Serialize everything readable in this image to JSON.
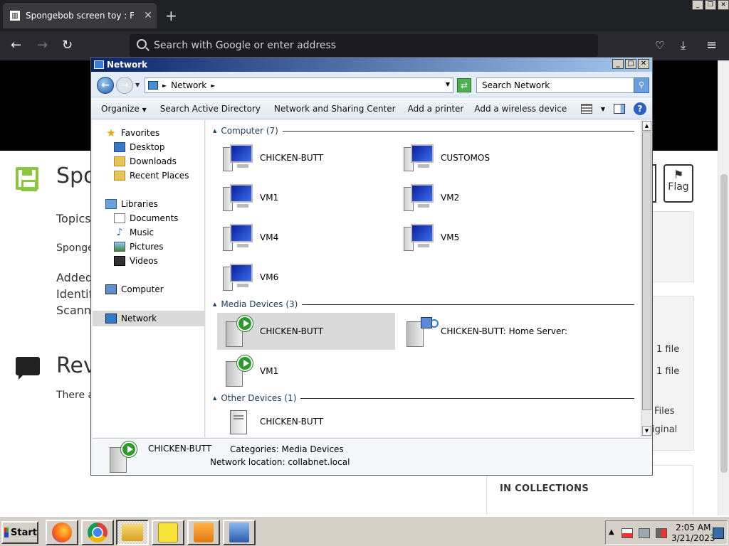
{
  "browser": {
    "tab_title": "Spongebob screen toy : Free Dow",
    "tab_close": "✕",
    "new_tab": "+",
    "address_placeholder": "Search with Google or enter address",
    "nav_icons": [
      "back-arrow-icon",
      "forward-arrow-icon",
      "reload-icon"
    ],
    "right_icons": [
      "pocket-icon",
      "download-icon",
      "menu-icon"
    ]
  },
  "webpage": {
    "title_fragment": "Spo",
    "topics_fragment": "Topics",
    "sponge_fragment": "Sponge",
    "added_fragment": "Added",
    "identif_fragment": "Identifi",
    "scann_fragment": "Scann",
    "reviews_fragment": "Rev",
    "there_fragment": "There a",
    "flag_label": "Flag",
    "file1": "1 file",
    "file2": "1 file",
    "files": "Files",
    "original_fragment": "iginal",
    "in_collections": "IN COLLECTIONS"
  },
  "explorer": {
    "title": "Network",
    "address": "Network",
    "search_placeholder": "Search Network",
    "commands": [
      "Organize",
      "Search Active Directory",
      "Network and Sharing Center",
      "Add a printer",
      "Add a wireless device"
    ],
    "nav": {
      "favorites": "Favorites",
      "desktop": "Desktop",
      "downloads": "Downloads",
      "recent": "Recent Places",
      "libraries": "Libraries",
      "documents": "Documents",
      "music": "Music",
      "pictures": "Pictures",
      "videos": "Videos",
      "computer": "Computer",
      "network": "Network"
    },
    "groups": {
      "computer": {
        "header": "Computer (7)",
        "items": [
          "CHICKEN-BUTT",
          "CUSTOMOS",
          "VM1",
          "VM2",
          "VM4",
          "VM5",
          "VM6"
        ]
      },
      "media": {
        "header": "Media Devices (3)",
        "items": [
          "CHICKEN-BUTT",
          "CHICKEN-BUTT: Home Server:",
          "VM1"
        ]
      },
      "other": {
        "header": "Other Devices (1)",
        "items": [
          "CHICKEN-BUTT"
        ]
      }
    },
    "details": {
      "name": "CHICKEN-BUTT",
      "categories": "Categories: Media Devices",
      "location": "Network location: collabnet.local"
    }
  },
  "taskbar": {
    "start": "Start",
    "time": "2:05 AM",
    "date": "3/21/2023",
    "apps": [
      "firefox-icon",
      "chrome-icon",
      "explorer-folder-icon",
      "spongebob-icon",
      "media-player-icon",
      "network-window-icon"
    ]
  }
}
